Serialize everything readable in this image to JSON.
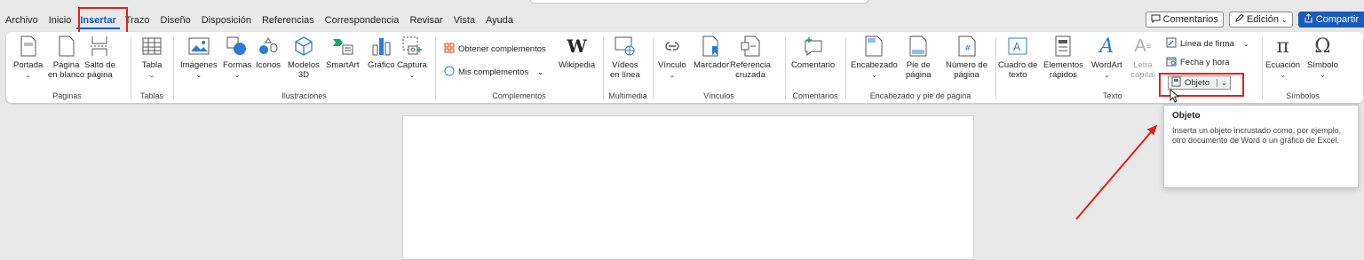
{
  "menu": {
    "items": [
      "Archivo",
      "Inicio",
      "Insertar",
      "Trazo",
      "Diseño",
      "Disposición",
      "Referencias",
      "Correspondencia",
      "Revisar",
      "Vista",
      "Ayuda"
    ],
    "active": "Insertar"
  },
  "actions": {
    "comments": "Comentarios",
    "editing": "Edición",
    "share": "Compartir"
  },
  "ribbon": {
    "paginas": {
      "label": "Páginas",
      "portada": "Portada",
      "pagina_blanco_1": "Página",
      "pagina_blanco_2": "en blanco",
      "salto_1": "Salto de",
      "salto_2": "página"
    },
    "tablas": {
      "label": "Tablas",
      "tabla": "Tabla"
    },
    "ilustraciones": {
      "label": "Ilustraciones",
      "imagenes": "Imágenes",
      "formas": "Formas",
      "iconos": "Iconos",
      "modelos_1": "Modelos",
      "modelos_2": "3D",
      "smartart": "SmartArt",
      "grafico": "Gráfico",
      "captura": "Captura"
    },
    "complementos": {
      "label": "Complementos",
      "obtener": "Obtener complementos",
      "mis": "Mis complementos",
      "wikipedia": "Wikipedia"
    },
    "multimedia": {
      "label": "Multimedia",
      "videos_1": "Vídeos",
      "videos_2": "en línea"
    },
    "vinculos": {
      "label": "Vínculos",
      "vinculo": "Vínculo",
      "marcador": "Marcador",
      "referencia_1": "Referencia",
      "referencia_2": "cruzada"
    },
    "comentarios": {
      "label": "Comentarios",
      "comentario": "Comentario"
    },
    "encabezado": {
      "label": "Encabezado y pie de página",
      "encabezado": "Encabezado",
      "pie_1": "Pie de",
      "pie_2": "página",
      "numero_1": "Número de",
      "numero_2": "página"
    },
    "texto": {
      "label": "Texto",
      "cuadro_1": "Cuadro de",
      "cuadro_2": "texto",
      "elementos_1": "Elementos",
      "elementos_2": "rápidos",
      "wordart": "WordArt",
      "letra_1": "Letra",
      "letra_2": "capital",
      "linea_firma": "Línea de firma",
      "fecha_hora": "Fecha y hora",
      "objeto": "Objeto"
    },
    "simbolos": {
      "label": "Símbolos",
      "ecuacion": "Ecuación",
      "simbolo": "Símbolo"
    }
  },
  "tooltip": {
    "title": "Objeto",
    "body": "Inserta un objeto incrustado como, por ejemplo, otro documento de Word o un gráfico de Excel."
  },
  "colors": {
    "accent": "#185abd",
    "highlight": "#e02020"
  }
}
